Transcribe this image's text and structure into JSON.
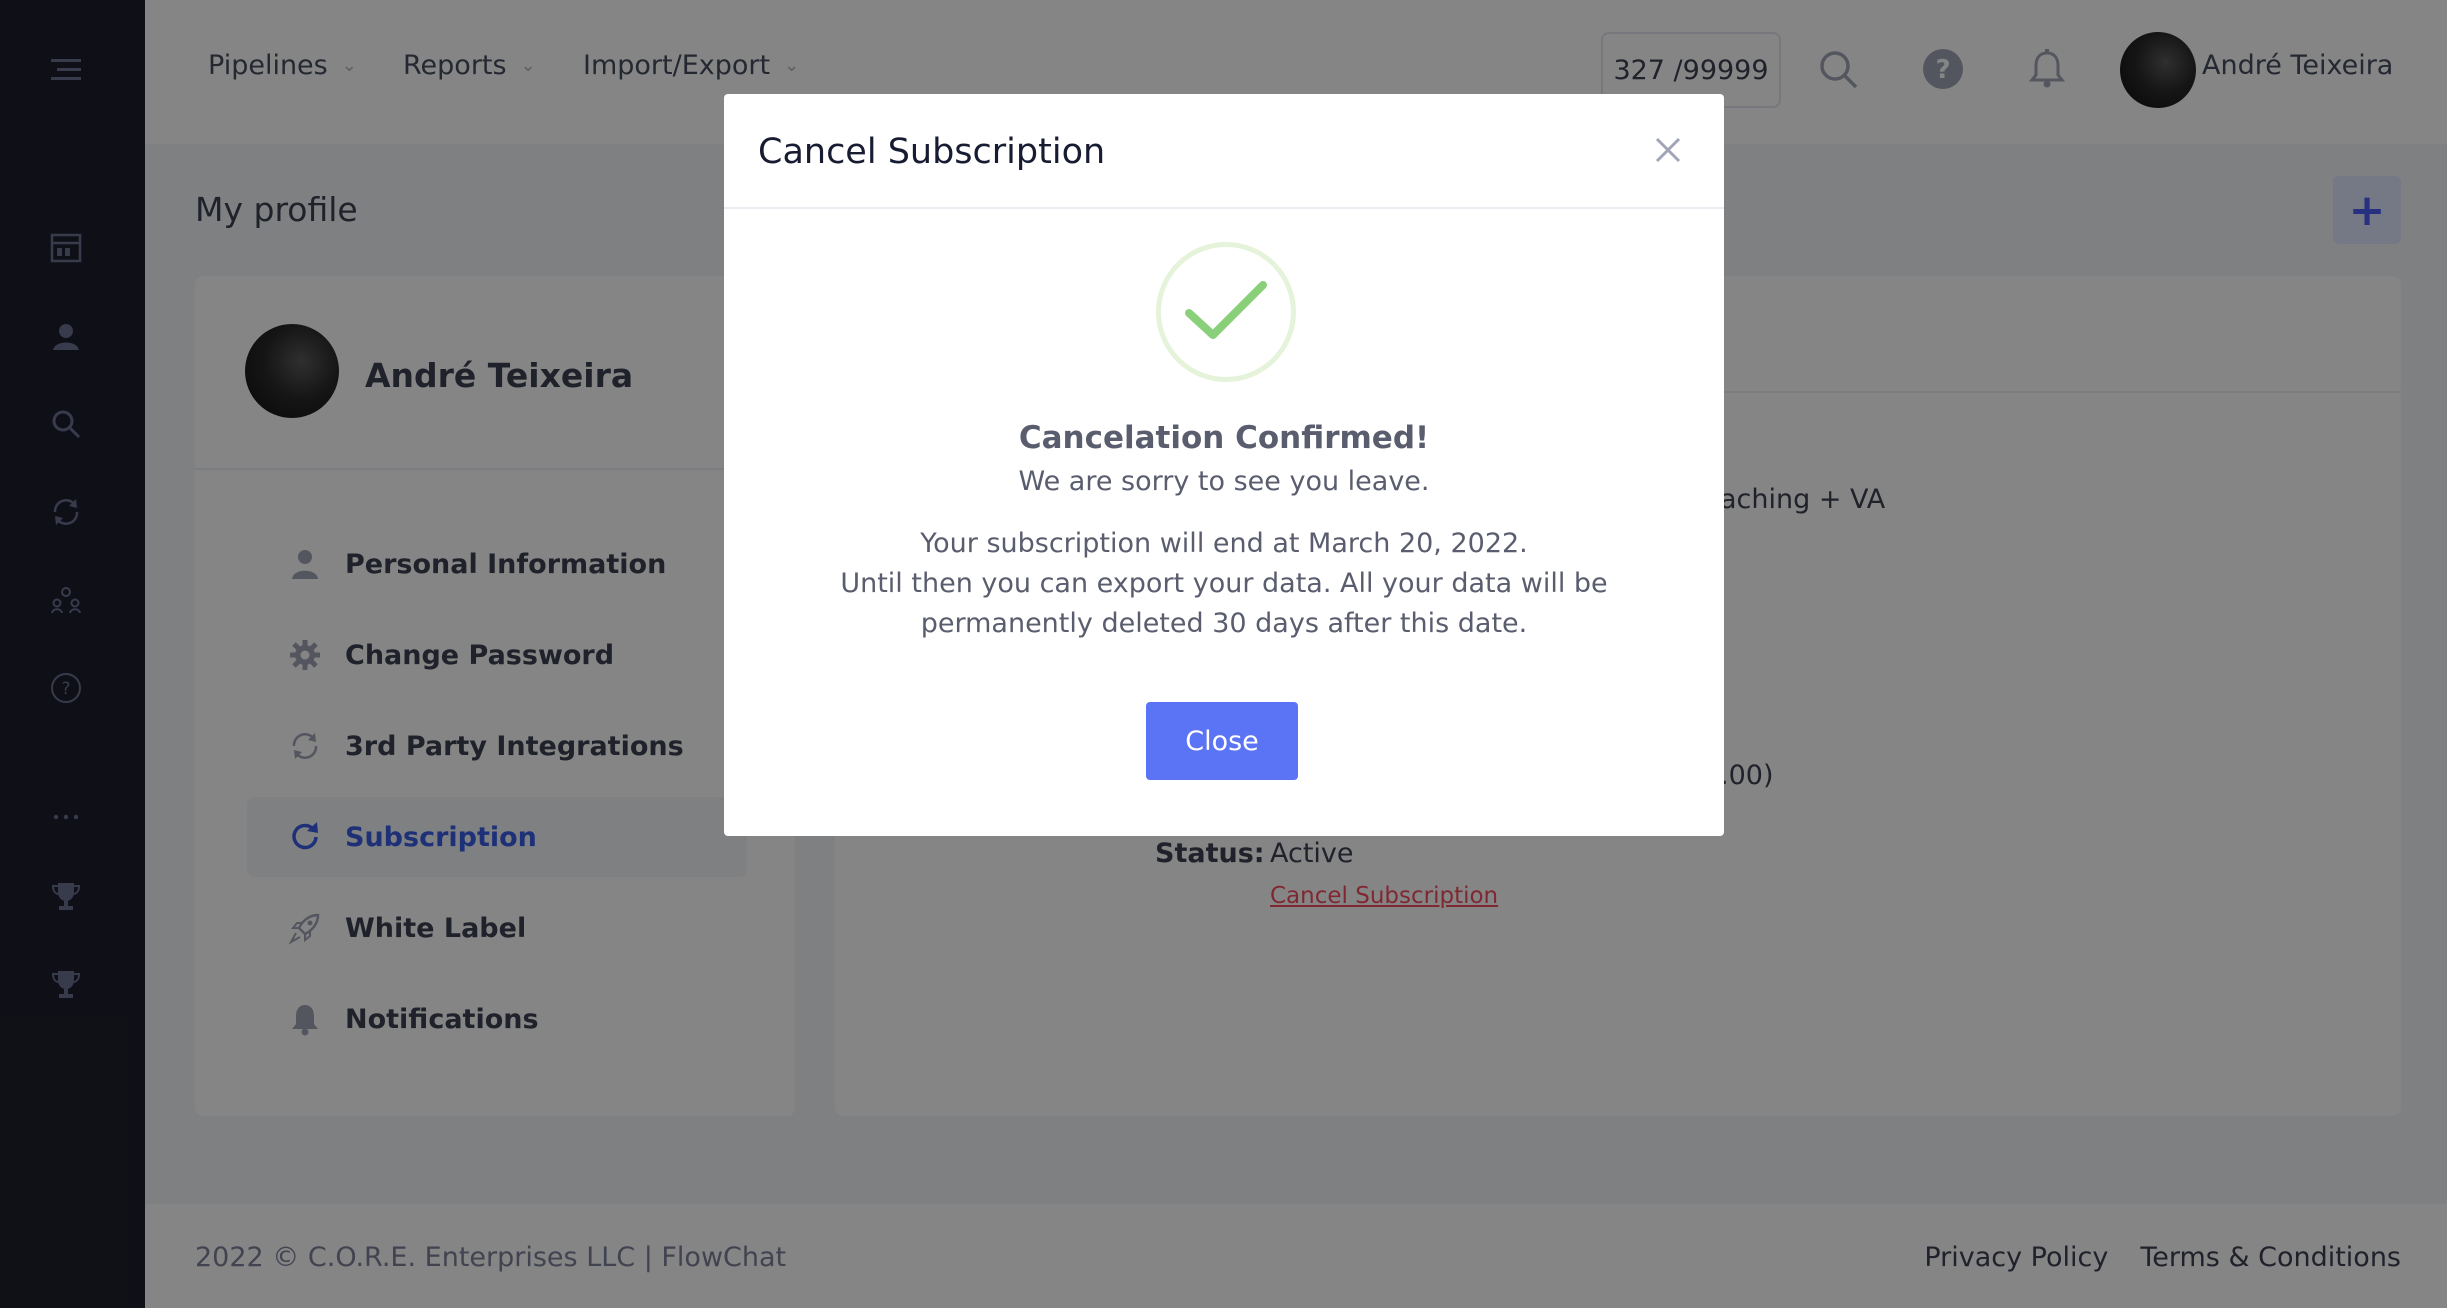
{
  "header": {
    "nav": [
      {
        "label": "Pipelines"
      },
      {
        "label": "Reports"
      },
      {
        "label": "Import/Export"
      }
    ],
    "counter": "327 /99999",
    "user_name": "André Teixeira"
  },
  "page": {
    "title": "My profile"
  },
  "profile": {
    "name": "André Teixeira",
    "menu": [
      {
        "label": "Personal Information",
        "icon": "user-icon"
      },
      {
        "label": "Change Password",
        "icon": "gear-icon"
      },
      {
        "label": "3rd Party Integrations",
        "icon": "sync-icon"
      },
      {
        "label": "Subscription",
        "icon": "refresh-icon",
        "active": true
      },
      {
        "label": "White Label",
        "icon": "rocket-icon"
      },
      {
        "label": "Notifications",
        "icon": "bell-icon"
      }
    ]
  },
  "subscription": {
    "plan_fragment": "aching + VA",
    "price_fragment": ".00)",
    "status_label": "Status:",
    "status_value": "Active",
    "cancel_link": "Cancel Subscription"
  },
  "footer": {
    "copyright": "2022 © C.O.R.E. Enterprises LLC | FlowChat",
    "privacy": "Privacy Policy",
    "terms": "Terms & Conditions"
  },
  "modal": {
    "title": "Cancel Subscription",
    "confirm_title": "Cancelation Confirmed!",
    "confirm_sub": "We are sorry to see you leave.",
    "body_line1": "Your subscription will end at March 20, 2022.",
    "body_line2": "Until then you can export your data. All your data will be",
    "body_line3": "permanently deleted 30 days after this date.",
    "close_button": "Close"
  },
  "colors": {
    "sidebar": "#1e1e2d",
    "primary": "#5b73f5",
    "danger": "#f64e60",
    "success": "#8ad07a"
  }
}
